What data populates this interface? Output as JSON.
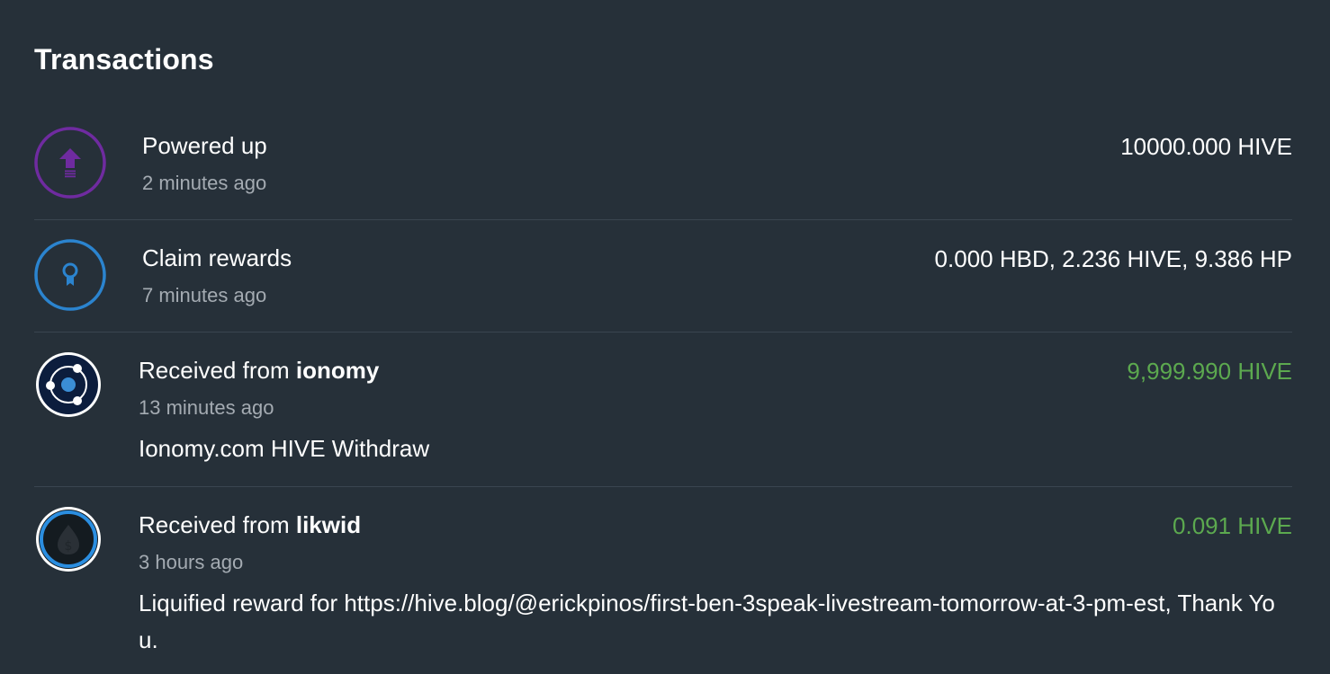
{
  "page": {
    "title": "Transactions"
  },
  "colors": {
    "background": "#263039",
    "powerup_accent": "#6f2ba0",
    "claim_accent": "#2b84cf",
    "received_amount": "#5ca94f",
    "muted_text": "#a4abb2"
  },
  "transactions": [
    {
      "icon": "power-up-arrow-icon",
      "action": "Powered up",
      "counterparty": "",
      "time": "2 minutes ago",
      "amount": "10000.000 HIVE",
      "memo": ""
    },
    {
      "icon": "award-ribbon-icon",
      "action": "Claim rewards",
      "counterparty": "",
      "time": "7 minutes ago",
      "amount": "0.000 HBD, 2.236 HIVE, 9.386 HP",
      "memo": ""
    },
    {
      "icon": "ionomy-avatar",
      "action": "Received from ",
      "counterparty": "ionomy",
      "time": "13 minutes ago",
      "amount": "9,999.990 HIVE",
      "memo": "Ionomy.com HIVE Withdraw"
    },
    {
      "icon": "likwid-avatar",
      "action": "Received from ",
      "counterparty": "likwid",
      "time": "3 hours ago",
      "amount": "0.091 HIVE",
      "memo": "Liquified reward for https://hive.blog/@erickpinos/first-ben-3speak-livestream-tomorrow-at-3-pm-est, Thank You."
    }
  ]
}
